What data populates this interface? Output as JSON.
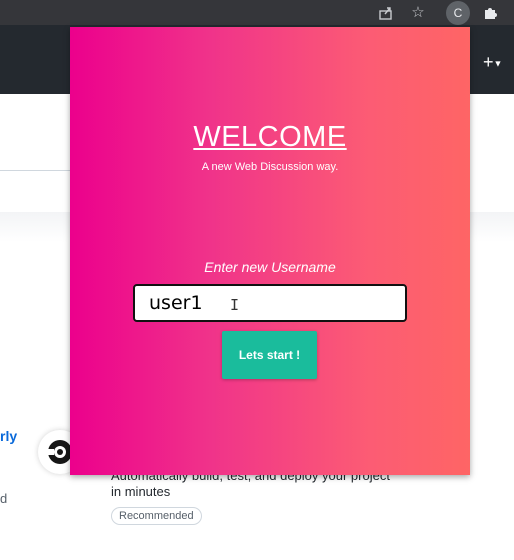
{
  "browser": {
    "share_icon": "share-icon",
    "star_icon": "star-icon",
    "profile_initial": "C",
    "extensions_icon": "puzzle-icon"
  },
  "background_page": {
    "plus_icon": "+",
    "link_fragment": "rly",
    "left_fragment": "d",
    "description": "Automatically build, test, and deploy your project in minutes",
    "badge": "Recommended"
  },
  "popup": {
    "title": "WELCOME",
    "tagline": "A new Web Discussion way.",
    "prompt": "Enter new Username",
    "username_value": "user1",
    "start_button": "Lets start !",
    "colors": {
      "gradient_start": "#ec008c",
      "gradient_end": "#fe6565",
      "button": "#1abc9c"
    }
  }
}
